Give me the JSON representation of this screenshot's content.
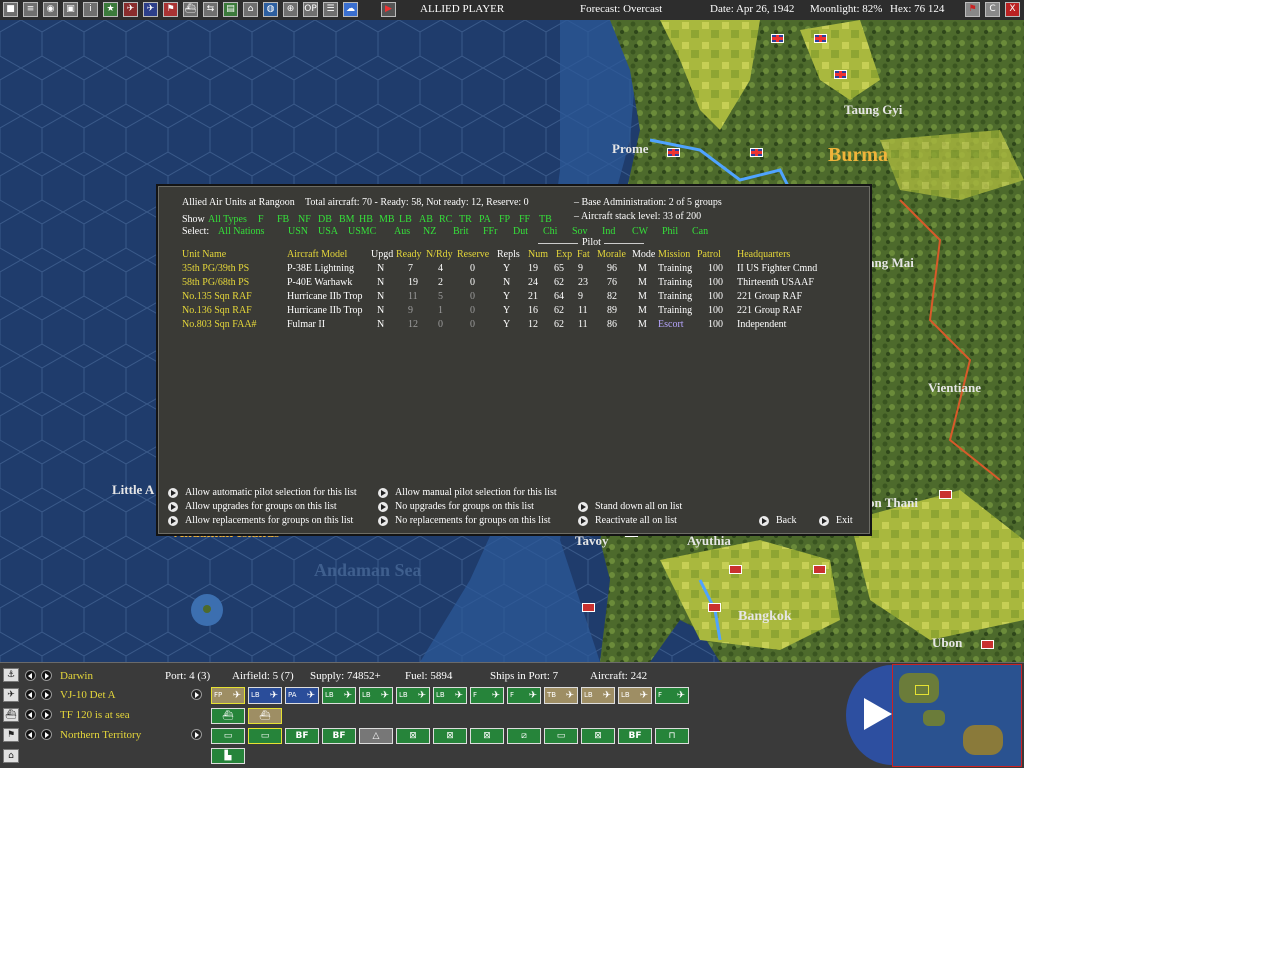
{
  "topbar": {
    "player": "ALLIED PLAYER",
    "forecast": "Forecast: Overcast",
    "date": "Date: Apr 26, 1942",
    "moonlight": "Moonlight: 82%",
    "hex": "Hex: 76 124",
    "right_buttons": [
      "flag",
      "C",
      "X"
    ]
  },
  "map": {
    "labels": [
      "Taung Gyi",
      "Prome",
      "Burma",
      "Vientiane",
      "ang Mai",
      "on Thani",
      "Little A",
      "Andaman Islands",
      "Andaman Sea",
      "Tavoy",
      "Ayuthia",
      "Bangkok",
      "Ubon"
    ]
  },
  "dialog": {
    "title": "Allied Air Units at Rangoon",
    "totals": "Total aircraft: 70 - Ready: 58, Not ready: 12, Reserve: 0",
    "base_admin": "– Base Administration: 2 of 5 groups",
    "stack_level": "– Aircraft stack level: 33 of 200",
    "show_label": "Show",
    "show_types": [
      "All Types",
      "F",
      "FB",
      "NF",
      "DB",
      "BM",
      "HB",
      "MB",
      "LB",
      "AB",
      "RC",
      "TR",
      "PA",
      "FP",
      "FF",
      "TB"
    ],
    "select_label": "Select:",
    "select_nations": [
      "All Nations",
      "USN",
      "USA",
      "USMC",
      "Aus",
      "NZ",
      "Brit",
      "FFr",
      "Dut",
      "Chi",
      "Sov",
      "Ind",
      "CW",
      "Phil",
      "Can"
    ],
    "pilot_group": "Pilot",
    "headers": {
      "unit": "Unit Name",
      "model": "Aircraft Model",
      "upgd": "Upgd",
      "ready": "Ready",
      "nrdy": "N/Rdy",
      "reserve": "Reserve",
      "repls": "Repls",
      "num": "Num",
      "exp": "Exp",
      "fat": "Fat",
      "morale": "Morale",
      "mode": "Mode",
      "mission": "Mission",
      "patrol": "Patrol",
      "hq": "Headquarters"
    },
    "rows": [
      {
        "unit": "35th PG/39th PS",
        "model": "P-38E Lightning",
        "upgd": "N",
        "ready": "7",
        "nrdy": "4",
        "reserve": "0",
        "repls": "Y",
        "num": "19",
        "exp": "65",
        "fat": "9",
        "morale": "96",
        "mode": "M",
        "mission": "Training",
        "patrol": "100",
        "hq": "II US Fighter Cmnd"
      },
      {
        "unit": "58th PG/68th PS",
        "model": "P-40E Warhawk",
        "upgd": "N",
        "ready": "19",
        "nrdy": "2",
        "reserve": "0",
        "repls": "N",
        "num": "24",
        "exp": "62",
        "fat": "23",
        "morale": "76",
        "mode": "M",
        "mission": "Training",
        "patrol": "100",
        "hq": "Thirteenth USAAF"
      },
      {
        "unit": "No.135 Sqn RAF",
        "model": "Hurricane IIb Trop",
        "upgd": "N",
        "ready": "11",
        "nrdy": "5",
        "reserve": "0",
        "repls": "Y",
        "num": "21",
        "exp": "64",
        "fat": "9",
        "morale": "82",
        "mode": "M",
        "mission": "Training",
        "patrol": "100",
        "hq": "221 Group RAF"
      },
      {
        "unit": "No.136 Sqn RAF",
        "model": "Hurricane IIb Trop",
        "upgd": "N",
        "ready": "9",
        "nrdy": "1",
        "reserve": "0",
        "repls": "Y",
        "num": "16",
        "exp": "62",
        "fat": "11",
        "morale": "89",
        "mode": "M",
        "mission": "Training",
        "patrol": "100",
        "hq": "221 Group RAF"
      },
      {
        "unit": "No.803 Sqn FAA#",
        "model": "Fulmar II",
        "upgd": "N",
        "ready": "12",
        "nrdy": "0",
        "reserve": "0",
        "repls": "Y",
        "num": "12",
        "exp": "62",
        "fat": "11",
        "morale": "86",
        "mode": "M",
        "mission": "Escort",
        "patrol": "100",
        "hq": "Independent"
      }
    ],
    "actions": {
      "auto_pilot": "Allow automatic pilot selection for this list",
      "manual_pilot": "Allow manual pilot selection for this list",
      "allow_upgrades": "Allow upgrades for groups on this list",
      "no_upgrades": "No upgrades for groups on this list",
      "stand_down": "Stand down all on list",
      "allow_repl": "Allow replacements for groups on this list",
      "no_repl": "No replacements for groups on this list",
      "reactivate": "Reactivate all on list",
      "back": "Back",
      "exit": "Exit"
    }
  },
  "bottom": {
    "base": "Darwin",
    "port": "Port: 4 (3)",
    "airfield": "Airfield: 5 (7)",
    "supply": "Supply: 74852+",
    "fuel": "Fuel: 5894",
    "ships": "Ships in Port: 7",
    "aircraft": "Aircraft: 242",
    "unit1": "VJ-10 Det A",
    "unit2": "TF 120 is at sea",
    "unit3": "Northern Territory",
    "air_buttons": [
      "FP",
      "LB",
      "PA",
      "LB",
      "LB",
      "LB",
      "LB",
      "F",
      "F",
      "TB",
      "LB",
      "LB",
      "F"
    ],
    "ground_buttons": [
      "BF",
      "BF",
      "BF"
    ]
  }
}
